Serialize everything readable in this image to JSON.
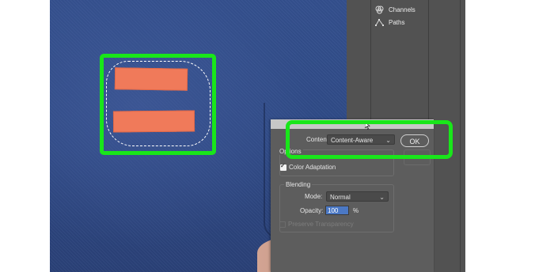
{
  "panel": {
    "items": [
      {
        "label": "Channels",
        "icon": "channels-icon"
      },
      {
        "label": "Paths",
        "icon": "paths-icon"
      }
    ]
  },
  "fill_dialog": {
    "contents_label": "Contents:",
    "contents_value": "Content-Aware",
    "ok_label": "OK",
    "options_title": "Options",
    "color_adaptation_label": "Color Adaptation",
    "color_adaptation_checked": true,
    "blending_title": "Blending",
    "mode_label": "Mode:",
    "mode_value": "Normal",
    "opacity_label": "Opacity:",
    "opacity_value": "100",
    "opacity_unit": "%",
    "preserve_transparency_label": "Preserve Transparency",
    "preserve_transparency_checked": false
  },
  "colors": {
    "highlight": "#19e61a",
    "tape": "#f07a5a",
    "shirt": "#2f4a86"
  }
}
